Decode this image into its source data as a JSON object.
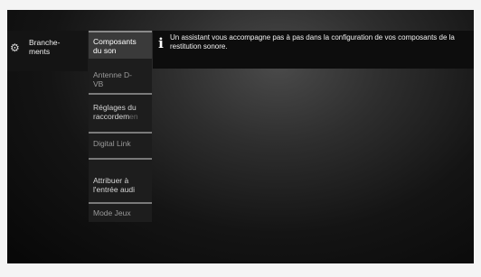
{
  "categories": [
    {
      "icon": "gear-icon",
      "label_line1": "Branche-",
      "label_line2": "ments"
    }
  ],
  "menu": {
    "items": [
      {
        "line1": "Composants",
        "line2": "du son",
        "selected": true
      },
      {
        "line1": "Antenne D-",
        "line2": "VB",
        "selected": false
      },
      {
        "line1": "Réglages du",
        "line2": "raccordem",
        "line2_fade": "en",
        "selected": false
      },
      {
        "line1": "Digital Link",
        "line2": "",
        "selected": false
      },
      {
        "line1": "Attribuer à",
        "line2": "l'entrée audi",
        "selected": false
      },
      {
        "line1": "Mode Jeux",
        "line2": "",
        "selected": false
      }
    ]
  },
  "info": {
    "icon": "info-icon",
    "text": "Un assistant vous accompagne pas à pas dans la configuration de vos composants de la restitution sonore."
  },
  "colors": {
    "selected_bg": "#3a3a3a",
    "menu_bg": "#1d1d1d",
    "separator": "#7a7a7a"
  }
}
